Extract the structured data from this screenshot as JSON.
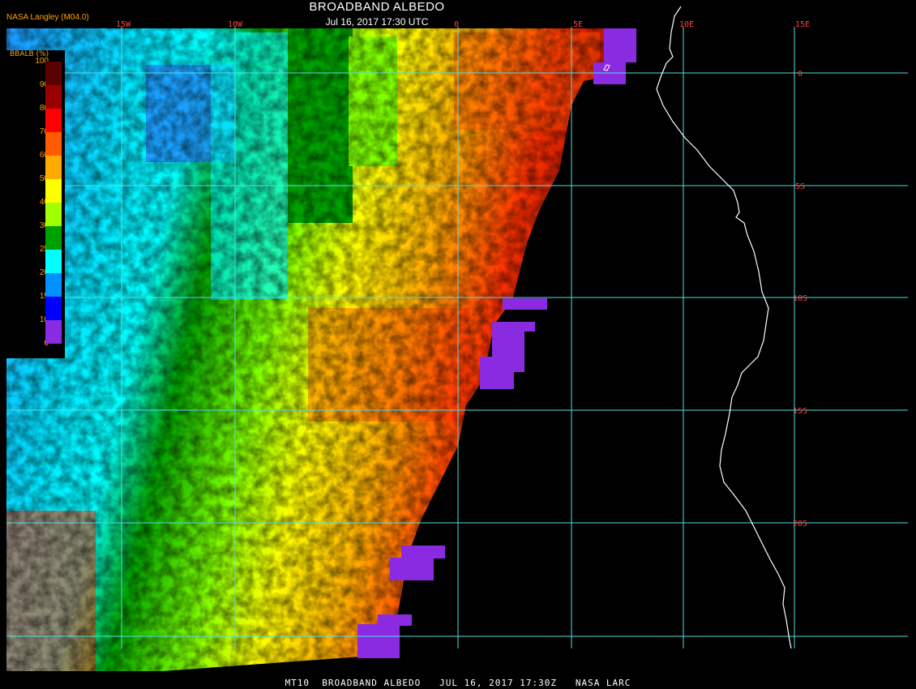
{
  "title": "BROADBAND ALBEDO",
  "subtitle": "Jul 16, 2017 17:30 UTC",
  "provider": "NASA Langley (M04.0)",
  "footer": "MT10  BROADBAND ALBEDO   JUL 16, 2017 17:30Z   NASA LARC",
  "legend": {
    "title": "BBALB (%)",
    "labels": [
      "100",
      "90",
      "80",
      "70",
      "60",
      "50",
      "40",
      "30",
      "25",
      "20",
      "15",
      "10",
      "0"
    ],
    "colors": [
      "#5a0000",
      "#9a0000",
      "#ff0000",
      "#ff5a00",
      "#ffaa00",
      "#ffff00",
      "#a0ff00",
      "#00a000",
      "#00ffff",
      "#0090ff",
      "#0000ff",
      "#8a2be2"
    ]
  },
  "lon_labels": [
    "15W",
    "10W",
    "0",
    "5E",
    "10E",
    "15E"
  ],
  "lat_labels": [
    "0",
    "5S",
    "10S",
    "15S",
    "20S"
  ],
  "colors": {
    "grid": "#4fe0e0",
    "tick_label": "#ff4040",
    "coast": "#ffffff",
    "nodata": "#8a2be2",
    "background": "#000000"
  }
}
